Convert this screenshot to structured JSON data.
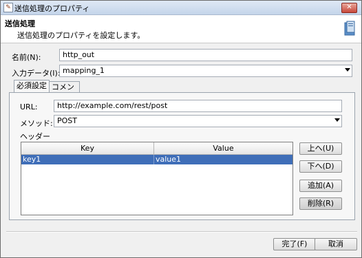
{
  "window": {
    "title": "送信処理のプロパティ",
    "close_label": "✕"
  },
  "header": {
    "title": "送信処理",
    "description": "送信処理のプロパティを設定します。",
    "icon": "document-icon"
  },
  "form": {
    "name_label": "名前(N):",
    "name_value": "http_out",
    "input_label": "入力データ(I):",
    "input_value": "mapping_1"
  },
  "tabs": [
    {
      "label": "必須設定"
    },
    {
      "label": "コメント"
    }
  ],
  "required": {
    "url_label": "URL:",
    "url_value": "http://example.com/rest/post",
    "method_label": "メソッド:",
    "method_value": "POST",
    "headers_label": "ヘッダー"
  },
  "table": {
    "columns": [
      "Key",
      "Value"
    ],
    "rows": [
      {
        "key": "key1",
        "value": "value1"
      }
    ]
  },
  "buttons": {
    "up": "上へ(U)",
    "down": "下へ(D)",
    "add": "追加(A)",
    "delete": "削除(R)",
    "finish": "完了(F)",
    "cancel": "取消"
  },
  "colors": {
    "selection": "#3f6eb8",
    "title_bar": "#c4d5ea"
  }
}
